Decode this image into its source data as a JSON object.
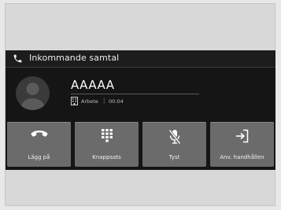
{
  "header": {
    "title": "Inkommande samtal",
    "icon": "phone-icon"
  },
  "caller": {
    "name": "AAAAA",
    "type": "Arbete",
    "separator": "|",
    "duration": "00:04",
    "avatar_icon": "person-silhouette-icon",
    "type_icon": "building-icon"
  },
  "actions": [
    {
      "label": "Lägg på",
      "icon": "hang-up-icon"
    },
    {
      "label": "Knappsats",
      "icon": "keypad-icon"
    },
    {
      "label": "Tyst",
      "icon": "mute-microphone-icon"
    },
    {
      "label": "Anv. handhållen",
      "icon": "transfer-to-handset-icon"
    }
  ],
  "colors": {
    "screen_background": "#151515",
    "button_background": "#6b6b6b",
    "text": "#ffffff"
  }
}
